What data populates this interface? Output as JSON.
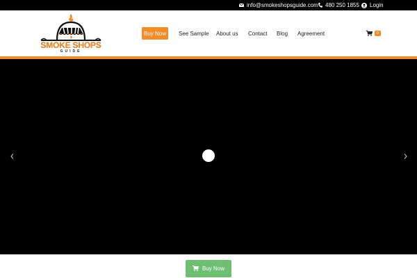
{
  "topbar": {
    "email": "info@smokeshopsguide.com",
    "phone": "480 250 1855",
    "login": "Login"
  },
  "logo": {
    "title": "SMOKE SHOPS",
    "subtitle": "GUIDE"
  },
  "nav": {
    "buy_now": "Buy Now",
    "items": [
      "See Sample",
      "About us",
      "Contact",
      "Blog",
      "Agreement"
    ],
    "cart_count": "0"
  },
  "bottom": {
    "buy_now": "Buy Now"
  },
  "colors": {
    "accent": "#f28c28",
    "green": "#6fbf73",
    "topbar": "#000000",
    "hero": "#000000"
  },
  "icons": [
    "envelope-icon",
    "phone-icon",
    "user-circle-icon",
    "cart-icon",
    "chevron-left-icon",
    "chevron-right-icon",
    "play-icon"
  ]
}
